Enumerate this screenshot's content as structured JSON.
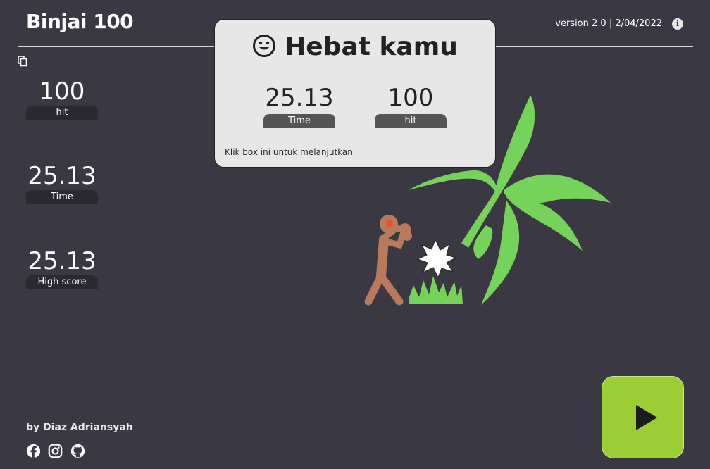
{
  "header": {
    "title": "Binjai 100",
    "version": "version 2.0 | 2/04/2022",
    "info_icon": "i"
  },
  "stats": [
    {
      "value": "100",
      "label": "hit"
    },
    {
      "value": "25.13",
      "label": "Time"
    },
    {
      "value": "25.13",
      "label": "High score"
    }
  ],
  "modal": {
    "title": "Hebat kamu",
    "stats": [
      {
        "value": "25.13",
        "label": "Time"
      },
      {
        "value": "100",
        "label": "hit"
      }
    ],
    "hint": "Klik box ini untuk melanjutkan"
  },
  "footer": {
    "author": "by Diaz Adriansyah",
    "social_icons": [
      "facebook-icon",
      "instagram-icon",
      "github-icon"
    ]
  },
  "colors": {
    "background": "#3a3843",
    "play_button": "#9bcd35",
    "banana_tree": "#76d35a",
    "fighter": "#b87a5a"
  }
}
